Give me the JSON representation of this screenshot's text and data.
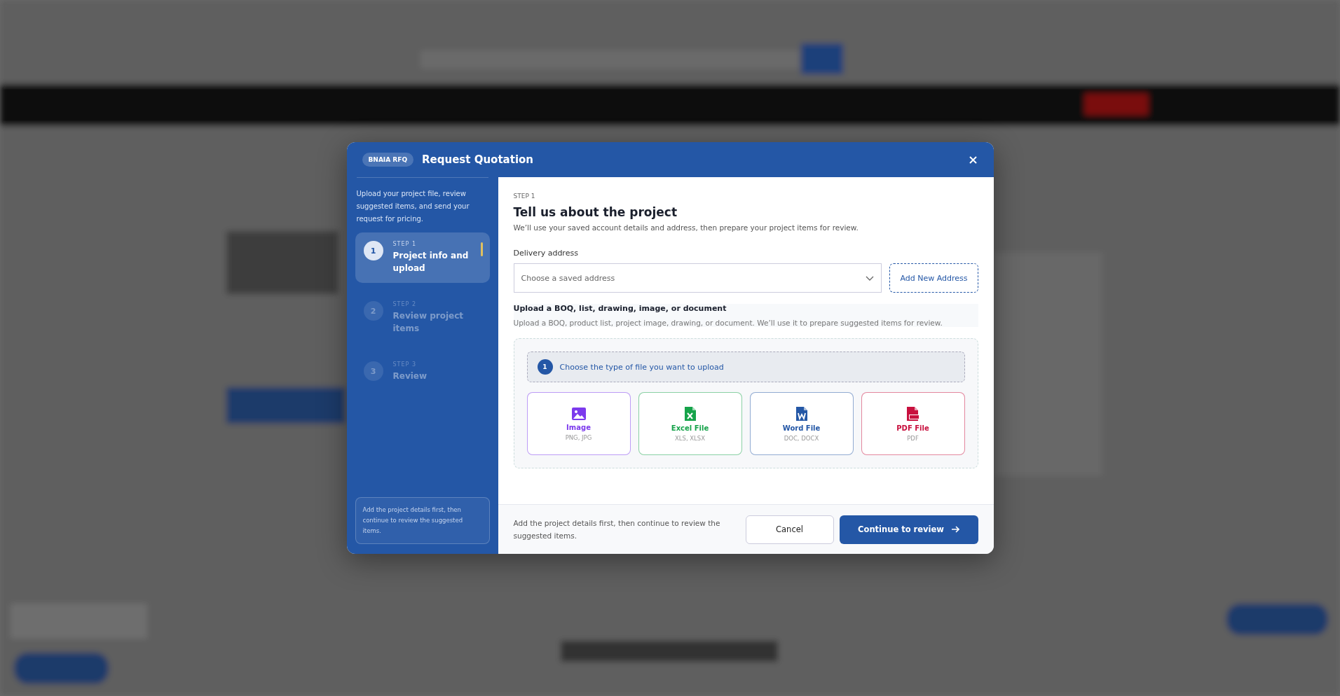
{
  "modal": {
    "badge": "BNAIA RFQ",
    "title": "Request Quotation",
    "sidebar": {
      "intro": "Upload your project file, review suggested items, and send your request for pricing.",
      "steps": [
        {
          "number": "1",
          "label": "STEP 1",
          "title": "Project info and upload",
          "selected": true
        },
        {
          "number": "2",
          "label": "STEP 2",
          "title": "Review project items",
          "selected": false
        },
        {
          "number": "3",
          "label": "STEP 3",
          "title": "Review",
          "selected": false
        }
      ],
      "note": "Add the project details first, then continue to review the suggested items."
    },
    "step_label": "STEP 1",
    "heading": "Tell us about the project",
    "subheading": "We’ll use your saved account details and address, then prepare your project items for review.",
    "delivery": {
      "label": "Delivery address",
      "placeholder": "Choose a saved address",
      "add_button": "Add New Address"
    },
    "upload": {
      "title": "Upload a BOQ, list, drawing, image, or document",
      "description": "Upload a BOQ, product list, project image, drawing, or document. We’ll use it to prepare suggested items for review.",
      "instruction_number": "1",
      "instruction": "Choose the type of file you want to upload",
      "file_types": [
        {
          "kind": "image",
          "name": "Image",
          "formats": "PNG, JPG",
          "color": "#7c3aed"
        },
        {
          "kind": "excel",
          "name": "Excel File",
          "formats": "XLS, XLSX",
          "color": "#16a34a"
        },
        {
          "kind": "word",
          "name": "Word File",
          "formats": "DOC, DOCX",
          "color": "#2457a6"
        },
        {
          "kind": "pdf",
          "name": "PDF File",
          "formats": "PDF",
          "color": "#c8103e"
        }
      ]
    },
    "footer": {
      "note": "Add the project details first, then continue to review the suggested items.",
      "cancel": "Cancel",
      "continue": "Continue to review"
    }
  }
}
